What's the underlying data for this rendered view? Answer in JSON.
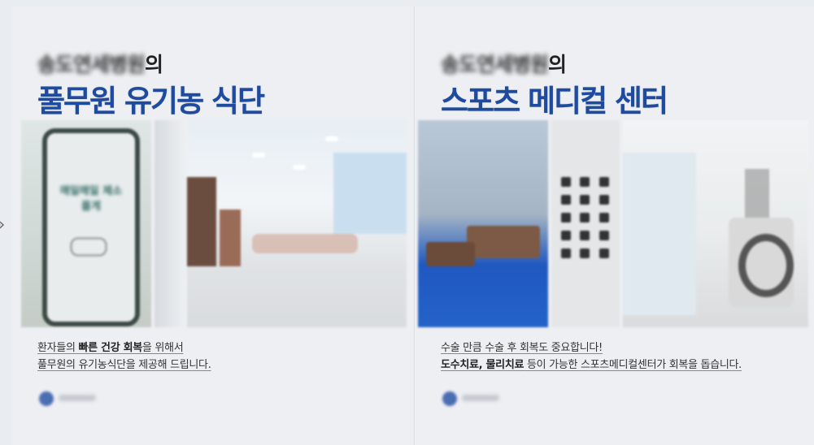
{
  "nav": {
    "prev_arrow": "»"
  },
  "cards": [
    {
      "subtitle_blurred": "송도연세병원",
      "subtitle_suffix": "의",
      "title": "풀무원 유기농 식단",
      "phone_text": "매일매일 제소플게",
      "desc": {
        "line1_pre": "환자들의 ",
        "line1_bold": "빠른 건강 회복",
        "line1_post": "을 위해서",
        "line2": "풀무원의 유기농식단을 제공해 드립니다."
      }
    },
    {
      "subtitle_blurred": "송도연세병원",
      "subtitle_suffix": "의",
      "title": "스포츠 메디컬 센터",
      "desc": {
        "line1": "수술 만큼 수술 후 회복도 중요합니다!",
        "line2_bold": "도수치료, 물리치료",
        "line2_post": " 등이 가능한 스포츠메디컬센터가 회복을 돕습니다."
      }
    }
  ],
  "colors": {
    "accent": "#1f4b9e",
    "background": "#eeeff2"
  }
}
